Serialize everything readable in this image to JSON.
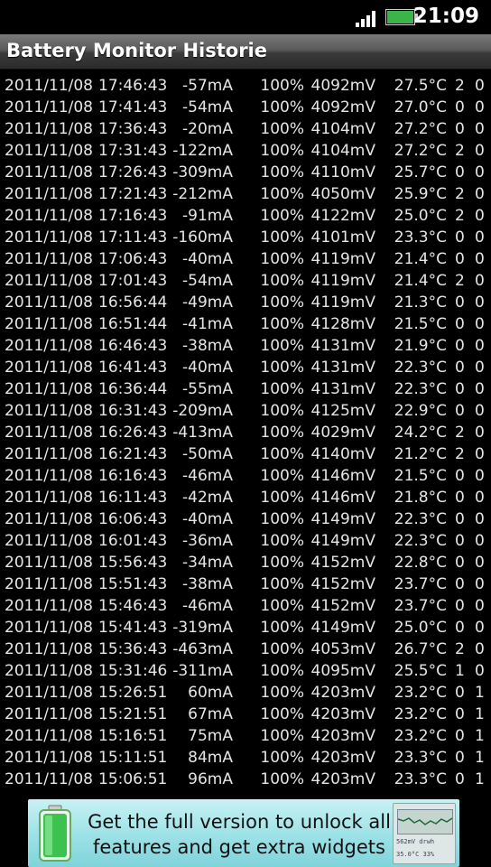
{
  "status_bar": {
    "time": "21:09",
    "signal_icon": "signal-bars-icon",
    "battery_icon": "battery-icon"
  },
  "app": {
    "title": "Battery Monitor Historie"
  },
  "log_rows": [
    {
      "date": "2011/11/08",
      "time": "17:46:43",
      "current": "-57mA",
      "percent": "100%",
      "voltage": "4092mV",
      "temp": "27.5°C",
      "a": "2",
      "b": "0"
    },
    {
      "date": "2011/11/08",
      "time": "17:41:43",
      "current": "-54mA",
      "percent": "100%",
      "voltage": "4092mV",
      "temp": "27.0°C",
      "a": "0",
      "b": "0"
    },
    {
      "date": "2011/11/08",
      "time": "17:36:43",
      "current": "-20mA",
      "percent": "100%",
      "voltage": "4104mV",
      "temp": "27.2°C",
      "a": "0",
      "b": "0"
    },
    {
      "date": "2011/11/08",
      "time": "17:31:43",
      "current": "-122mA",
      "percent": "100%",
      "voltage": "4104mV",
      "temp": "27.2°C",
      "a": "2",
      "b": "0"
    },
    {
      "date": "2011/11/08",
      "time": "17:26:43",
      "current": "-309mA",
      "percent": "100%",
      "voltage": "4110mV",
      "temp": "25.7°C",
      "a": "0",
      "b": "0"
    },
    {
      "date": "2011/11/08",
      "time": "17:21:43",
      "current": "-212mA",
      "percent": "100%",
      "voltage": "4050mV",
      "temp": "25.9°C",
      "a": "2",
      "b": "0"
    },
    {
      "date": "2011/11/08",
      "time": "17:16:43",
      "current": "-91mA",
      "percent": "100%",
      "voltage": "4122mV",
      "temp": "25.0°C",
      "a": "2",
      "b": "0"
    },
    {
      "date": "2011/11/08",
      "time": "17:11:43",
      "current": "-160mA",
      "percent": "100%",
      "voltage": "4101mV",
      "temp": "23.3°C",
      "a": "0",
      "b": "0"
    },
    {
      "date": "2011/11/08",
      "time": "17:06:43",
      "current": "-40mA",
      "percent": "100%",
      "voltage": "4119mV",
      "temp": "21.4°C",
      "a": "0",
      "b": "0"
    },
    {
      "date": "2011/11/08",
      "time": "17:01:43",
      "current": "-54mA",
      "percent": "100%",
      "voltage": "4119mV",
      "temp": "21.4°C",
      "a": "2",
      "b": "0"
    },
    {
      "date": "2011/11/08",
      "time": "16:56:44",
      "current": "-49mA",
      "percent": "100%",
      "voltage": "4119mV",
      "temp": "21.3°C",
      "a": "0",
      "b": "0"
    },
    {
      "date": "2011/11/08",
      "time": "16:51:44",
      "current": "-41mA",
      "percent": "100%",
      "voltage": "4128mV",
      "temp": "21.5°C",
      "a": "0",
      "b": "0"
    },
    {
      "date": "2011/11/08",
      "time": "16:46:43",
      "current": "-38mA",
      "percent": "100%",
      "voltage": "4131mV",
      "temp": "21.9°C",
      "a": "0",
      "b": "0"
    },
    {
      "date": "2011/11/08",
      "time": "16:41:43",
      "current": "-40mA",
      "percent": "100%",
      "voltage": "4131mV",
      "temp": "22.3°C",
      "a": "0",
      "b": "0"
    },
    {
      "date": "2011/11/08",
      "time": "16:36:44",
      "current": "-55mA",
      "percent": "100%",
      "voltage": "4131mV",
      "temp": "22.3°C",
      "a": "0",
      "b": "0"
    },
    {
      "date": "2011/11/08",
      "time": "16:31:43",
      "current": "-209mA",
      "percent": "100%",
      "voltage": "4125mV",
      "temp": "22.9°C",
      "a": "0",
      "b": "0"
    },
    {
      "date": "2011/11/08",
      "time": "16:26:43",
      "current": "-413mA",
      "percent": "100%",
      "voltage": "4029mV",
      "temp": "24.2°C",
      "a": "2",
      "b": "0"
    },
    {
      "date": "2011/11/08",
      "time": "16:21:43",
      "current": "-50mA",
      "percent": "100%",
      "voltage": "4140mV",
      "temp": "21.2°C",
      "a": "2",
      "b": "0"
    },
    {
      "date": "2011/11/08",
      "time": "16:16:43",
      "current": "-46mA",
      "percent": "100%",
      "voltage": "4146mV",
      "temp": "21.5°C",
      "a": "0",
      "b": "0"
    },
    {
      "date": "2011/11/08",
      "time": "16:11:43",
      "current": "-42mA",
      "percent": "100%",
      "voltage": "4146mV",
      "temp": "21.8°C",
      "a": "0",
      "b": "0"
    },
    {
      "date": "2011/11/08",
      "time": "16:06:43",
      "current": "-40mA",
      "percent": "100%",
      "voltage": "4149mV",
      "temp": "22.3°C",
      "a": "0",
      "b": "0"
    },
    {
      "date": "2011/11/08",
      "time": "16:01:43",
      "current": "-36mA",
      "percent": "100%",
      "voltage": "4149mV",
      "temp": "22.3°C",
      "a": "0",
      "b": "0"
    },
    {
      "date": "2011/11/08",
      "time": "15:56:43",
      "current": "-34mA",
      "percent": "100%",
      "voltage": "4152mV",
      "temp": "22.8°C",
      "a": "0",
      "b": "0"
    },
    {
      "date": "2011/11/08",
      "time": "15:51:43",
      "current": "-38mA",
      "percent": "100%",
      "voltage": "4152mV",
      "temp": "23.7°C",
      "a": "0",
      "b": "0"
    },
    {
      "date": "2011/11/08",
      "time": "15:46:43",
      "current": "-46mA",
      "percent": "100%",
      "voltage": "4152mV",
      "temp": "23.7°C",
      "a": "0",
      "b": "0"
    },
    {
      "date": "2011/11/08",
      "time": "15:41:43",
      "current": "-319mA",
      "percent": "100%",
      "voltage": "4149mV",
      "temp": "25.0°C",
      "a": "0",
      "b": "0"
    },
    {
      "date": "2011/11/08",
      "time": "15:36:43",
      "current": "-463mA",
      "percent": "100%",
      "voltage": "4053mV",
      "temp": "26.7°C",
      "a": "2",
      "b": "0"
    },
    {
      "date": "2011/11/08",
      "time": "15:31:46",
      "current": "-311mA",
      "percent": "100%",
      "voltage": "4095mV",
      "temp": "25.5°C",
      "a": "1",
      "b": "0"
    },
    {
      "date": "2011/11/08",
      "time": "15:26:51",
      "current": "60mA",
      "percent": "100%",
      "voltage": "4203mV",
      "temp": "23.2°C",
      "a": "0",
      "b": "1"
    },
    {
      "date": "2011/11/08",
      "time": "15:21:51",
      "current": "67mA",
      "percent": "100%",
      "voltage": "4203mV",
      "temp": "23.2°C",
      "a": "0",
      "b": "1"
    },
    {
      "date": "2011/11/08",
      "time": "15:16:51",
      "current": "75mA",
      "percent": "100%",
      "voltage": "4203mV",
      "temp": "23.2°C",
      "a": "0",
      "b": "1"
    },
    {
      "date": "2011/11/08",
      "time": "15:11:51",
      "current": "84mA",
      "percent": "100%",
      "voltage": "4203mV",
      "temp": "23.3°C",
      "a": "0",
      "b": "1"
    },
    {
      "date": "2011/11/08",
      "time": "15:06:51",
      "current": "96mA",
      "percent": "100%",
      "voltage": "4203mV",
      "temp": "23.3°C",
      "a": "0",
      "b": "1"
    }
  ],
  "ad": {
    "line1": "Get the full version to unlock all",
    "line2": "features and get extra widgets",
    "icon": "green-battery-icon",
    "widget_icon": "battery-widget-preview-icon",
    "widget_line1": "562mV  drwh",
    "widget_line2": "35.0°C  33%"
  },
  "colors": {
    "background": "#000000",
    "text": "#e6e6e6",
    "ad_background": "#9fe3e8",
    "battery_green": "#39b54a"
  }
}
